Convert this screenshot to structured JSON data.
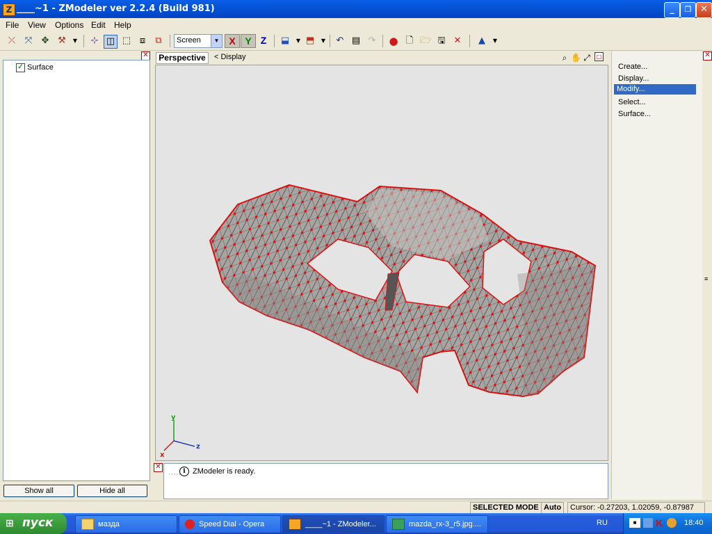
{
  "window": {
    "title": "____~1 - ZModeler ver 2.2.4 (Build 981)",
    "app_icon": "Z",
    "minimize_glyph": "_",
    "maximize_glyph": "❐",
    "close_glyph": "✕"
  },
  "menu": {
    "items": [
      "File",
      "View",
      "Options",
      "Edit",
      "Help"
    ]
  },
  "toolbar": {
    "coord_mode": "Screen",
    "axis_x": "X",
    "axis_y": "Y",
    "axis_z": "Z"
  },
  "left_panel": {
    "tree_items": [
      {
        "label": "Surface",
        "checked": true
      }
    ],
    "show_all_label": "Show all",
    "hide_all_label": "Hide all"
  },
  "viewport": {
    "view_name": "Perspective",
    "breadcrumb": "< Display",
    "axis_labels": {
      "x": "x",
      "y": "y",
      "z": "z"
    }
  },
  "right_panel": {
    "commands": [
      "Create...",
      "Display...",
      "Modify...",
      "Select...",
      "Surface..."
    ],
    "selected_command": "Modify..."
  },
  "log": {
    "message": "ZModeler is ready."
  },
  "status": {
    "mode": "SELECTED MODE",
    "snap": "Auto",
    "cursor": "Cursor: -0.27203, 1.02059, -0.87987"
  },
  "taskbar": {
    "start_label": "пуск",
    "tasks": [
      {
        "label": "мазда",
        "icon": "folder-icon",
        "active": false
      },
      {
        "label": "Speed Dial - Opera",
        "icon": "opera-icon",
        "active": false
      },
      {
        "label": "____~1 - ZModeler...",
        "icon": "zmodeler-icon",
        "active": true
      },
      {
        "label": "mazda_rx-3_r5.jpg....",
        "icon": "image-viewer-icon",
        "active": false
      }
    ],
    "language": "RU",
    "clock": "18:40"
  },
  "colors": {
    "title_bar": "#0553d6",
    "mesh_fill": "#a8a4a2",
    "vertex": "#e01010",
    "selected_command_bg": "#316ac5"
  }
}
